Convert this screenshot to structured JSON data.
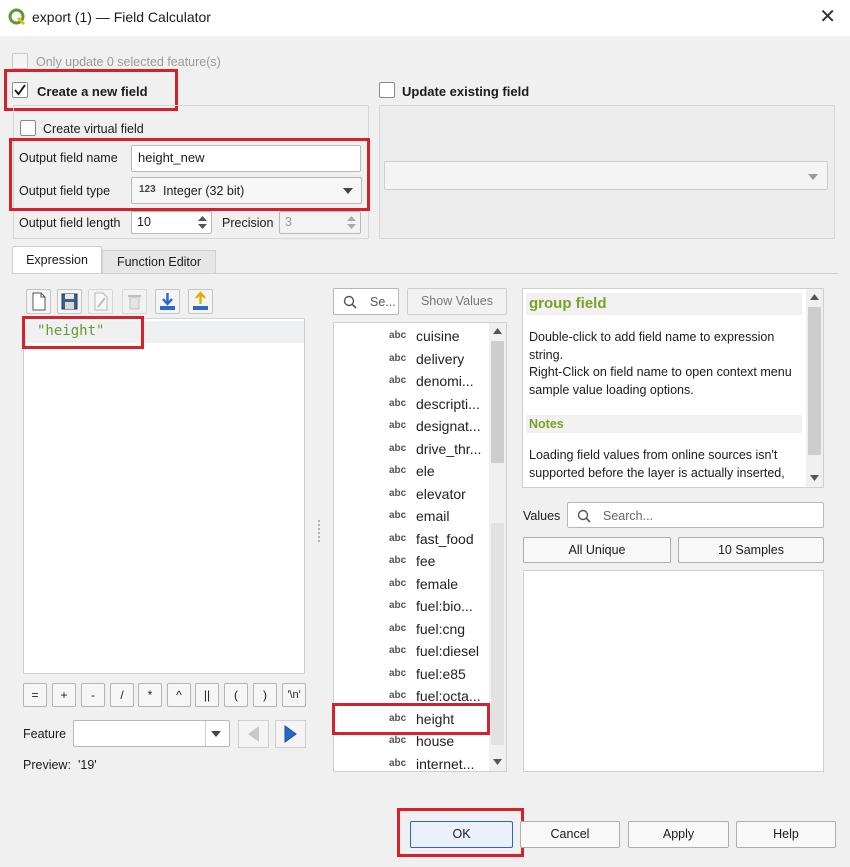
{
  "window": {
    "title": "export (1) — Field Calculator"
  },
  "options": {
    "only_update_label": "Only update 0 selected feature(s)",
    "create_new_label": "Create a new field",
    "update_existing_label": "Update existing field",
    "create_virtual_label": "Create virtual field",
    "output_name_label": "Output field name",
    "output_name_value": "height_new",
    "output_type_label": "Output field type",
    "output_type_prefix": "123",
    "output_type_value": "Integer (32 bit)",
    "output_length_label": "Output field length",
    "output_length_value": "10",
    "precision_label": "Precision",
    "precision_value": "3"
  },
  "tabs": [
    {
      "label": "Expression",
      "active": true
    },
    {
      "label": "Function Editor",
      "active": false
    }
  ],
  "editor": {
    "expression": "\"height\""
  },
  "operators": [
    "=",
    "+",
    "-",
    "/",
    "*",
    "^",
    "||",
    "(",
    ")",
    "'\\n'"
  ],
  "feature": {
    "label": "Feature",
    "value": "",
    "preview_label": "Preview:",
    "preview_value": "'19'"
  },
  "search": {
    "placeholder": "Se...",
    "show_values_label": "Show Values"
  },
  "fields": [
    {
      "type": "abc",
      "name": "cuisine"
    },
    {
      "type": "abc",
      "name": "delivery"
    },
    {
      "type": "abc",
      "name": "denomi..."
    },
    {
      "type": "abc",
      "name": "descripti..."
    },
    {
      "type": "abc",
      "name": "designat..."
    },
    {
      "type": "abc",
      "name": "drive_thr..."
    },
    {
      "type": "abc",
      "name": "ele"
    },
    {
      "type": "abc",
      "name": "elevator"
    },
    {
      "type": "abc",
      "name": "email"
    },
    {
      "type": "abc",
      "name": "fast_food"
    },
    {
      "type": "abc",
      "name": "fee"
    },
    {
      "type": "abc",
      "name": "female"
    },
    {
      "type": "abc",
      "name": "fuel:bio..."
    },
    {
      "type": "abc",
      "name": "fuel:cng"
    },
    {
      "type": "abc",
      "name": "fuel:diesel"
    },
    {
      "type": "abc",
      "name": "fuel:e85"
    },
    {
      "type": "abc",
      "name": "fuel:octa..."
    },
    {
      "type": "abc",
      "name": "height"
    },
    {
      "type": "abc",
      "name": "house"
    },
    {
      "type": "abc",
      "name": "internet..."
    }
  ],
  "help": {
    "heading": "group field",
    "line1": "Double-click to add field name to expression string.",
    "line2": "Right-Click on field name to open context menu sample value loading options.",
    "notes_heading": "Notes",
    "notes_text": "Loading field values from online sources isn't supported before the layer is actually inserted,"
  },
  "values": {
    "label": "Values",
    "search_placeholder": "Search...",
    "all_unique_label": "All Unique",
    "samples_label": "10 Samples"
  },
  "buttons": {
    "ok": "OK",
    "cancel": "Cancel",
    "apply": "Apply",
    "help": "Help"
  },
  "colors": {
    "accent": "#2b66c9",
    "highlight": "#d6202a",
    "expression_green": "#6a9a2c",
    "help_heading": "#7aa12a"
  }
}
